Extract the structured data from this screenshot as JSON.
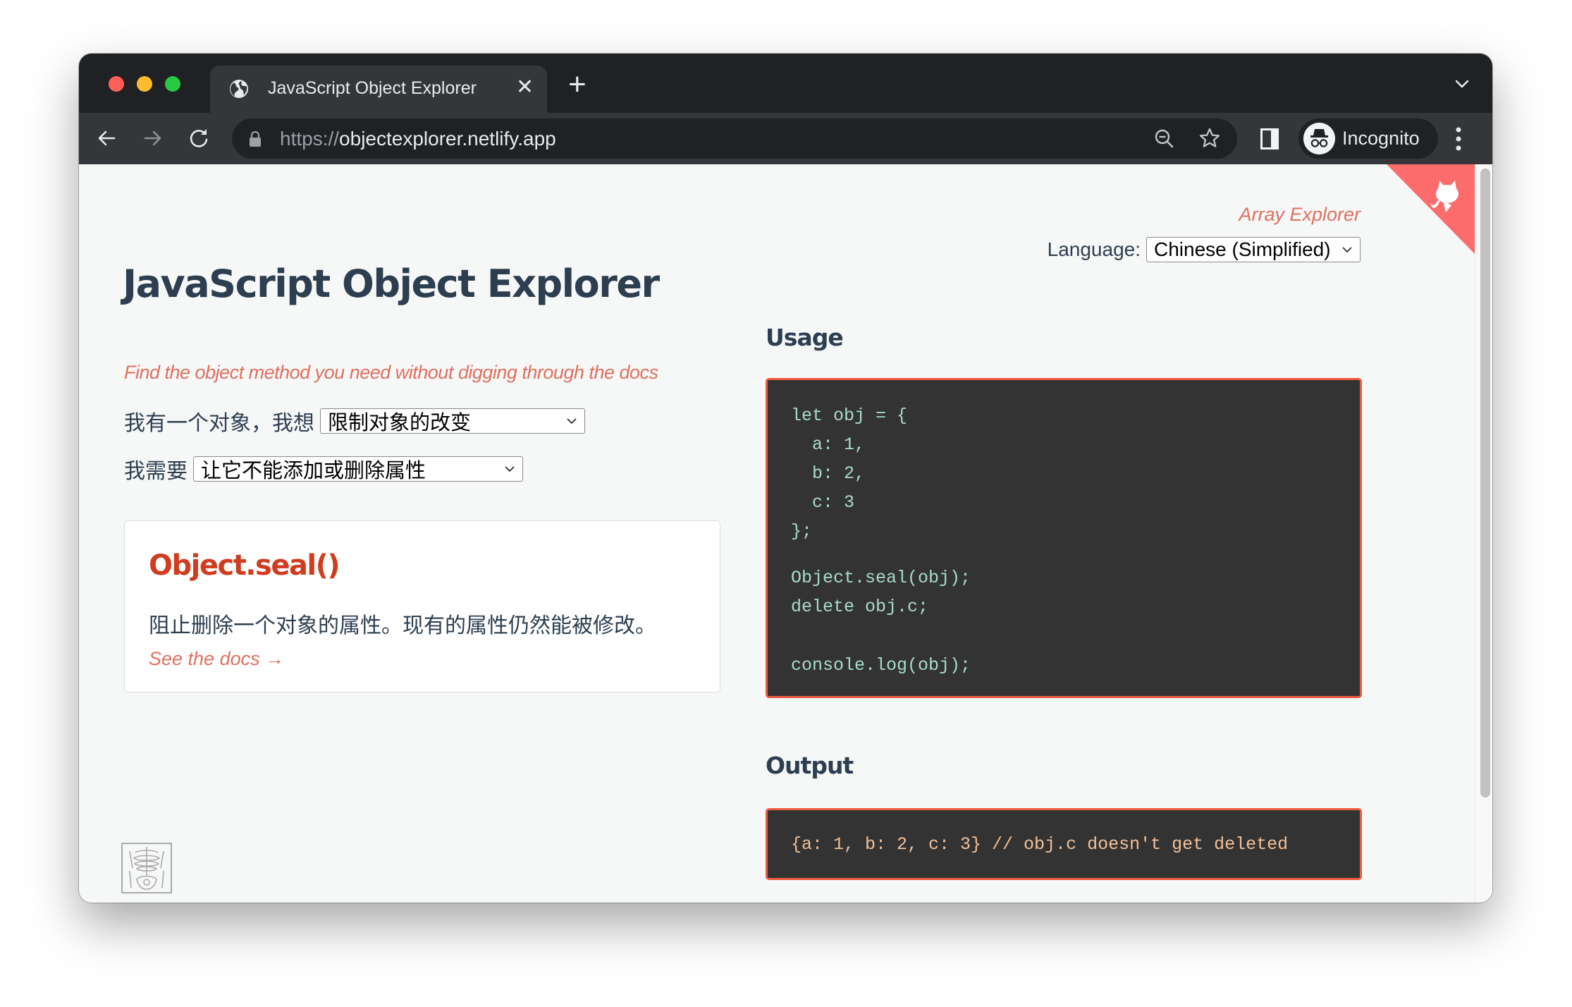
{
  "browser": {
    "tab": {
      "title": "JavaScript Object Explorer",
      "icon": "globe-icon",
      "close": "✕"
    },
    "new_tab_label": "+",
    "address_bar": {
      "scheme": "https://",
      "host": "objectexplorer.netlify.app"
    },
    "incognito_label": "Incognito"
  },
  "page": {
    "title": "JavaScript Object Explorer",
    "subtitle": "Find the object method you need without digging through the docs",
    "question1": {
      "label": "我有一个对象，我想",
      "selected": "限制对象的改变"
    },
    "question2": {
      "label": "我需要",
      "selected": "让它不能添加或删除属性"
    },
    "result": {
      "method": "Object.seal()",
      "description": "阻止删除一个对象的属性。现有的属性仍然能被修改。",
      "docs_link": "See the docs →"
    },
    "array_explorer_link": "Array Explorer",
    "language": {
      "label": "Language:",
      "selected": "Chinese (Simplified)"
    },
    "usage": {
      "heading": "Usage",
      "code_block1": [
        "let obj = {",
        "  a: 1,",
        "  b: 2,",
        "  c: 3",
        "};"
      ],
      "code_block2": [
        "Object.seal(obj);",
        "delete obj.c;"
      ],
      "code_block3": [
        "console.log(obj);"
      ]
    },
    "output": {
      "heading": "Output",
      "text": "{a: 1, b: 2, c: 3} // obj.c doesn't get deleted"
    }
  },
  "colors": {
    "accent": "#e0705f",
    "method_title": "#d13b1e",
    "heading": "#2c3e50",
    "code_bg": "#333333",
    "code_border": "#ee5a3f",
    "github_corner": "#fd6c6c"
  }
}
